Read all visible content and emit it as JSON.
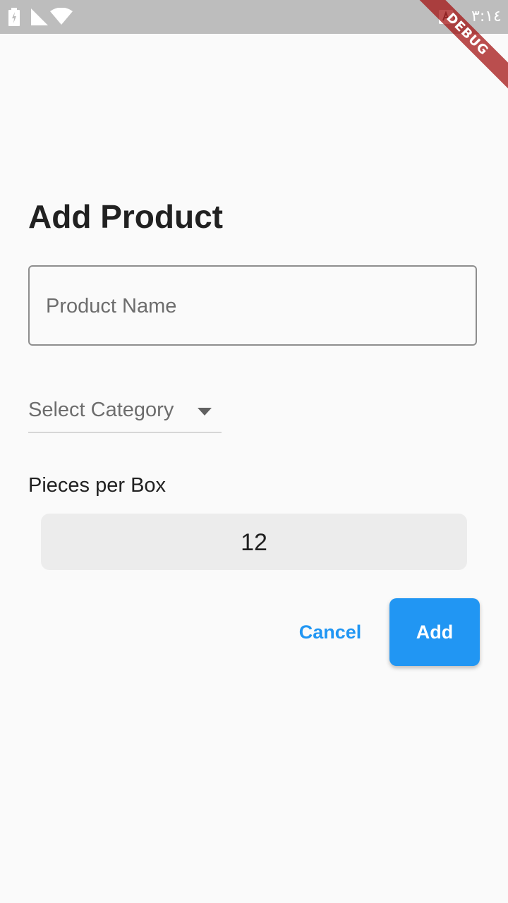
{
  "status_bar": {
    "time": "٣:١٤",
    "icons": [
      "battery-charging-icon",
      "signal-icon",
      "wifi-icon",
      "keyboard-icon"
    ]
  },
  "debug_banner": "DEBUG",
  "form": {
    "title": "Add Product",
    "product_name_placeholder": "Product Name",
    "category_placeholder": "Select Category",
    "pieces_label": "Pieces per Box",
    "pieces_value": "12",
    "cancel_label": "Cancel",
    "add_label": "Add"
  },
  "colors": {
    "accent": "#2196f3",
    "status_bar": "#bdbdbd",
    "background": "#fafafa",
    "debug_ribbon": "#a41414"
  }
}
